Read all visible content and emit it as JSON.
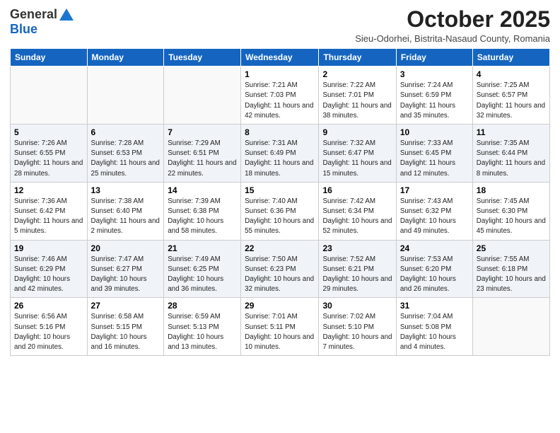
{
  "logo": {
    "general": "General",
    "blue": "Blue"
  },
  "header": {
    "month": "October 2025",
    "location": "Sieu-Odorhei, Bistrita-Nasaud County, Romania"
  },
  "weekdays": [
    "Sunday",
    "Monday",
    "Tuesday",
    "Wednesday",
    "Thursday",
    "Friday",
    "Saturday"
  ],
  "weeks": [
    [
      {
        "day": "",
        "info": ""
      },
      {
        "day": "",
        "info": ""
      },
      {
        "day": "",
        "info": ""
      },
      {
        "day": "1",
        "info": "Sunrise: 7:21 AM\nSunset: 7:03 PM\nDaylight: 11 hours and 42 minutes."
      },
      {
        "day": "2",
        "info": "Sunrise: 7:22 AM\nSunset: 7:01 PM\nDaylight: 11 hours and 38 minutes."
      },
      {
        "day": "3",
        "info": "Sunrise: 7:24 AM\nSunset: 6:59 PM\nDaylight: 11 hours and 35 minutes."
      },
      {
        "day": "4",
        "info": "Sunrise: 7:25 AM\nSunset: 6:57 PM\nDaylight: 11 hours and 32 minutes."
      }
    ],
    [
      {
        "day": "5",
        "info": "Sunrise: 7:26 AM\nSunset: 6:55 PM\nDaylight: 11 hours and 28 minutes."
      },
      {
        "day": "6",
        "info": "Sunrise: 7:28 AM\nSunset: 6:53 PM\nDaylight: 11 hours and 25 minutes."
      },
      {
        "day": "7",
        "info": "Sunrise: 7:29 AM\nSunset: 6:51 PM\nDaylight: 11 hours and 22 minutes."
      },
      {
        "day": "8",
        "info": "Sunrise: 7:31 AM\nSunset: 6:49 PM\nDaylight: 11 hours and 18 minutes."
      },
      {
        "day": "9",
        "info": "Sunrise: 7:32 AM\nSunset: 6:47 PM\nDaylight: 11 hours and 15 minutes."
      },
      {
        "day": "10",
        "info": "Sunrise: 7:33 AM\nSunset: 6:45 PM\nDaylight: 11 hours and 12 minutes."
      },
      {
        "day": "11",
        "info": "Sunrise: 7:35 AM\nSunset: 6:44 PM\nDaylight: 11 hours and 8 minutes."
      }
    ],
    [
      {
        "day": "12",
        "info": "Sunrise: 7:36 AM\nSunset: 6:42 PM\nDaylight: 11 hours and 5 minutes."
      },
      {
        "day": "13",
        "info": "Sunrise: 7:38 AM\nSunset: 6:40 PM\nDaylight: 11 hours and 2 minutes."
      },
      {
        "day": "14",
        "info": "Sunrise: 7:39 AM\nSunset: 6:38 PM\nDaylight: 10 hours and 58 minutes."
      },
      {
        "day": "15",
        "info": "Sunrise: 7:40 AM\nSunset: 6:36 PM\nDaylight: 10 hours and 55 minutes."
      },
      {
        "day": "16",
        "info": "Sunrise: 7:42 AM\nSunset: 6:34 PM\nDaylight: 10 hours and 52 minutes."
      },
      {
        "day": "17",
        "info": "Sunrise: 7:43 AM\nSunset: 6:32 PM\nDaylight: 10 hours and 49 minutes."
      },
      {
        "day": "18",
        "info": "Sunrise: 7:45 AM\nSunset: 6:30 PM\nDaylight: 10 hours and 45 minutes."
      }
    ],
    [
      {
        "day": "19",
        "info": "Sunrise: 7:46 AM\nSunset: 6:29 PM\nDaylight: 10 hours and 42 minutes."
      },
      {
        "day": "20",
        "info": "Sunrise: 7:47 AM\nSunset: 6:27 PM\nDaylight: 10 hours and 39 minutes."
      },
      {
        "day": "21",
        "info": "Sunrise: 7:49 AM\nSunset: 6:25 PM\nDaylight: 10 hours and 36 minutes."
      },
      {
        "day": "22",
        "info": "Sunrise: 7:50 AM\nSunset: 6:23 PM\nDaylight: 10 hours and 32 minutes."
      },
      {
        "day": "23",
        "info": "Sunrise: 7:52 AM\nSunset: 6:21 PM\nDaylight: 10 hours and 29 minutes."
      },
      {
        "day": "24",
        "info": "Sunrise: 7:53 AM\nSunset: 6:20 PM\nDaylight: 10 hours and 26 minutes."
      },
      {
        "day": "25",
        "info": "Sunrise: 7:55 AM\nSunset: 6:18 PM\nDaylight: 10 hours and 23 minutes."
      }
    ],
    [
      {
        "day": "26",
        "info": "Sunrise: 6:56 AM\nSunset: 5:16 PM\nDaylight: 10 hours and 20 minutes."
      },
      {
        "day": "27",
        "info": "Sunrise: 6:58 AM\nSunset: 5:15 PM\nDaylight: 10 hours and 16 minutes."
      },
      {
        "day": "28",
        "info": "Sunrise: 6:59 AM\nSunset: 5:13 PM\nDaylight: 10 hours and 13 minutes."
      },
      {
        "day": "29",
        "info": "Sunrise: 7:01 AM\nSunset: 5:11 PM\nDaylight: 10 hours and 10 minutes."
      },
      {
        "day": "30",
        "info": "Sunrise: 7:02 AM\nSunset: 5:10 PM\nDaylight: 10 hours and 7 minutes."
      },
      {
        "day": "31",
        "info": "Sunrise: 7:04 AM\nSunset: 5:08 PM\nDaylight: 10 hours and 4 minutes."
      },
      {
        "day": "",
        "info": ""
      }
    ]
  ]
}
